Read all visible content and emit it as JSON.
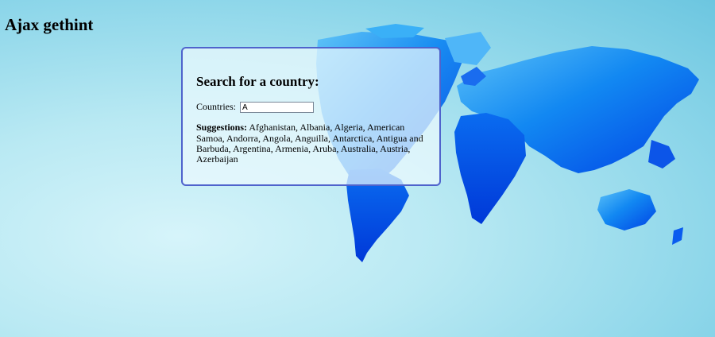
{
  "page": {
    "title": "Ajax gethint"
  },
  "search_panel": {
    "heading": "Search for a country:",
    "countries_label": "Countries:",
    "input_value": "A",
    "suggestions_label": "Suggestions:",
    "suggestions_text": "Afghanistan, Albania, Algeria, American Samoa, Andorra, Angola, Anguilla, Antarctica, Antigua and Barbuda, Argentina, Armenia, Aruba, Australia, Austria, Azerbaijan"
  },
  "colors": {
    "panel_border": "#4f63cc",
    "map_blue_light": "#2fa0f6",
    "map_blue_dark": "#0047e6",
    "background_light": "#d6f4fa",
    "background_dark": "#6cc6e0"
  },
  "icons": {
    "background": "world-map-image"
  }
}
